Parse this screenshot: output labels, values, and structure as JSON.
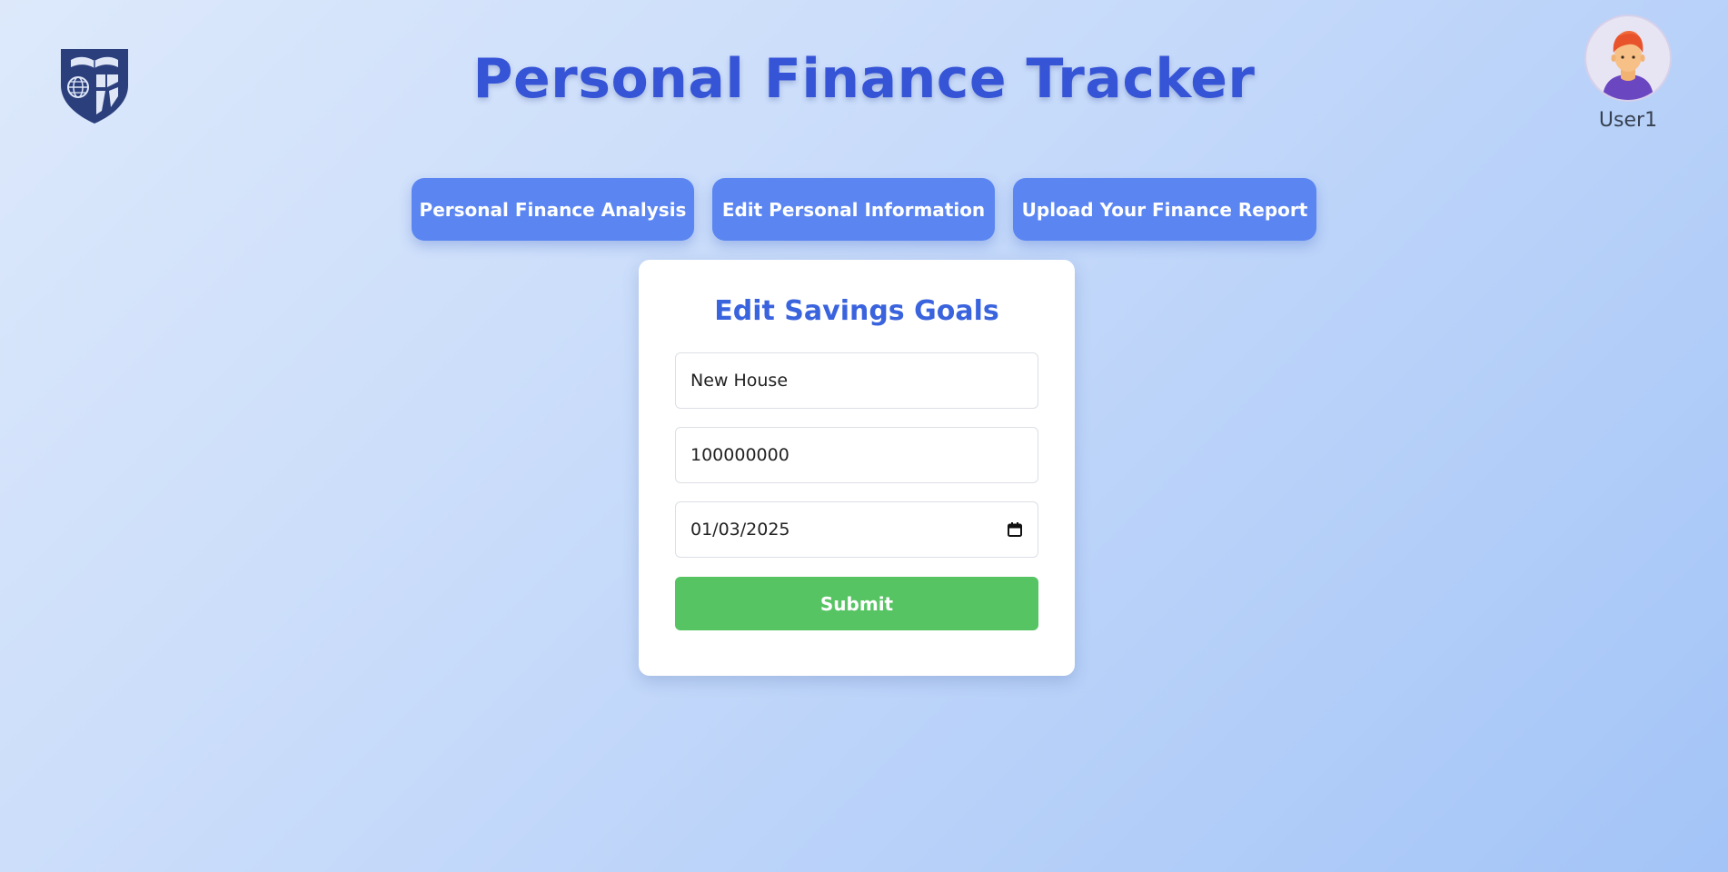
{
  "header": {
    "logo_icon": "university-shield-logo",
    "title": "Personal Finance Tracker",
    "user": {
      "name": "User1",
      "avatar_icon": "user-avatar"
    }
  },
  "nav": {
    "buttons": [
      {
        "label": "Personal Finance Analysis"
      },
      {
        "label": "Edit Personal Information"
      },
      {
        "label": "Upload Your Finance Report"
      }
    ]
  },
  "form": {
    "title": "Edit Savings Goals",
    "goal_name": "New House",
    "goal_amount": "100000000",
    "target_date": "01/03/2025",
    "submit_label": "Submit"
  },
  "colors": {
    "title": "#3654d6",
    "nav_button": "#5b86f2",
    "card_title": "#3a63de",
    "submit": "#57c463"
  }
}
